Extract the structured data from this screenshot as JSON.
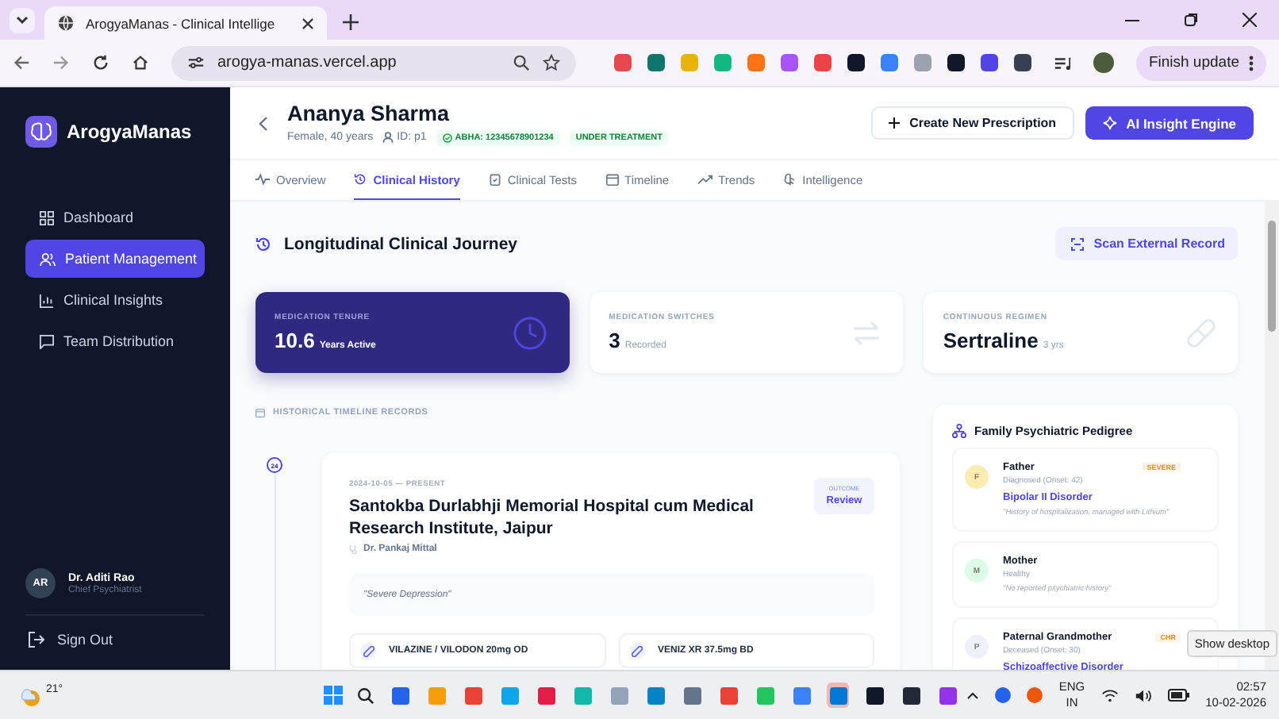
{
  "browser": {
    "tab_title": "ArogyaManas - Clinical Intellige",
    "url": "arogya-manas.vercel.app",
    "update_button": "Finish update"
  },
  "sidebar": {
    "brand": "ArogyaManas",
    "nav": [
      {
        "label": "Dashboard",
        "selected": false
      },
      {
        "label": "Patient Management",
        "selected": true
      },
      {
        "label": "Clinical Insights",
        "selected": false
      },
      {
        "label": "Team Distribution",
        "selected": false
      }
    ],
    "user": {
      "initials": "AR",
      "name": "Dr. Aditi Rao",
      "role": "Chief Psychiatrist"
    },
    "sign_out": "Sign Out"
  },
  "patient": {
    "name": "Ananya Sharma",
    "demographics": "Female, 40 years",
    "id": "ID: p1",
    "abha": "ABHA: 12345678901234",
    "status": "UNDER TREATMENT",
    "buttons": [
      {
        "label": "Create New Prescription",
        "kind": "secondary"
      },
      {
        "label": "AI Insight Engine",
        "kind": "primary"
      }
    ]
  },
  "tabs": [
    {
      "label": "Overview",
      "selected": false
    },
    {
      "label": "Clinical History",
      "selected": true
    },
    {
      "label": "Clinical Tests",
      "selected": false
    },
    {
      "label": "Timeline",
      "selected": false
    },
    {
      "label": "Trends",
      "selected": false
    },
    {
      "label": "Intelligence",
      "selected": false
    }
  ],
  "section": {
    "title": "Longitudinal Clinical Journey",
    "scan_button": "Scan External Record"
  },
  "stats": [
    {
      "label": "MEDICATION TENURE",
      "value": "10.6",
      "unit": "Years Active",
      "kind": "highlight"
    },
    {
      "label": "MEDICATION SWITCHES",
      "value": "3",
      "unit": "Recorded",
      "kind": "plain"
    },
    {
      "label": "CONTINUOUS REGIMEN",
      "value": "Sertraline",
      "unit": "3 yrs",
      "kind": "plain"
    }
  ],
  "timeline": {
    "label": "HISTORICAL TIMELINE RECORDS",
    "records": [
      {
        "number": "24",
        "dates": "2024-10-05 — PRESENT",
        "hospital": "Santokba Durlabhji Memorial Hospital cum Medical Research Institute, Jaipur",
        "doctor": "Dr. Pankaj Mittal",
        "outcome_label": "OUTCOME",
        "outcome": "Review",
        "note": "\"Severe Depression\"",
        "medications": [
          "VILAZINE / VILODON 20mg OD",
          "VENIZ XR 37.5mg BD"
        ]
      }
    ]
  },
  "pedigree": {
    "title": "Family Psychiatric Pedigree",
    "members": [
      {
        "initial": "F",
        "relation": "Father",
        "status": "Diagnosed (Onset: 42)",
        "diagnosis": "Bipolar II Disorder",
        "note": "\"History of hospitalization, managed with Lithium\"",
        "severity": "SEVERE",
        "color": "#fdecb2"
      },
      {
        "initial": "M",
        "relation": "Mother",
        "status": "Healthy",
        "note": "\"No reported psychiatric history\"",
        "color": "#dcfce7"
      },
      {
        "initial": "P",
        "relation": "Paternal Grandmother",
        "status": "Deceased (Onset: 30)",
        "diagnosis": "Schizoaffective Disorder",
        "severity": "CHR",
        "color": "#eef0fa"
      }
    ]
  },
  "tooltip": "Show desktop",
  "taskbar": {
    "weather": "21°",
    "language": "ENG",
    "region": "IN",
    "time": "02:57",
    "date": "10-02-2026"
  }
}
